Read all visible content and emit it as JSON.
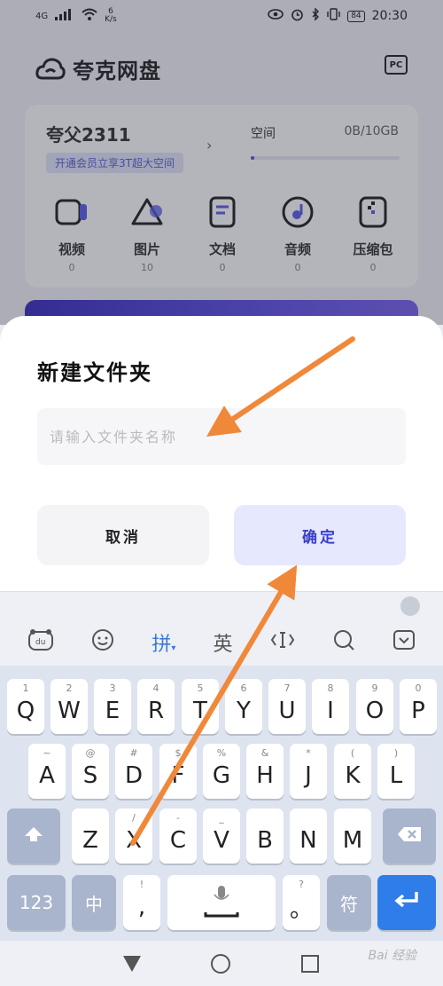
{
  "status_bar": {
    "network": "4G",
    "speed_value": "6",
    "speed_unit": "K/s",
    "battery": "84",
    "time": "20:30"
  },
  "app": {
    "title": "夸克网盘",
    "pc_label": "PC"
  },
  "user": {
    "name": "夸父2311",
    "vip_prompt": "开通会员立享3T超大空间",
    "space_label": "空间",
    "space_value": "0B/10GB",
    "space_used_fraction": 0
  },
  "categories": [
    {
      "label": "视频",
      "count": "0",
      "icon": "video-icon"
    },
    {
      "label": "图片",
      "count": "10",
      "icon": "image-icon"
    },
    {
      "label": "文档",
      "count": "0",
      "icon": "document-icon"
    },
    {
      "label": "音频",
      "count": "0",
      "icon": "audio-icon"
    },
    {
      "label": "压缩包",
      "count": "0",
      "icon": "archive-icon"
    }
  ],
  "dialog": {
    "title": "新建文件夹",
    "input_placeholder": "请输入文件夹名称",
    "input_value": "",
    "cancel_label": "取消",
    "confirm_label": "确定"
  },
  "keyboard_toolbar": {
    "pinyin_label": "拼",
    "english_label": "英"
  },
  "keyboard": {
    "row1": [
      {
        "num": "1",
        "key": "Q"
      },
      {
        "num": "2",
        "key": "W"
      },
      {
        "num": "3",
        "key": "E"
      },
      {
        "num": "4",
        "key": "R"
      },
      {
        "num": "5",
        "key": "T"
      },
      {
        "num": "6",
        "key": "Y"
      },
      {
        "num": "7",
        "key": "U"
      },
      {
        "num": "8",
        "key": "I"
      },
      {
        "num": "9",
        "key": "O"
      },
      {
        "num": "0",
        "key": "P"
      }
    ],
    "row2": [
      {
        "sym": "~",
        "key": "A"
      },
      {
        "sym": "@",
        "key": "S"
      },
      {
        "sym": "#",
        "key": "D"
      },
      {
        "sym": "$",
        "key": "F"
      },
      {
        "sym": "%",
        "key": "G"
      },
      {
        "sym": "&",
        "key": "H"
      },
      {
        "sym": "*",
        "key": "J"
      },
      {
        "sym": "(",
        "key": "K"
      },
      {
        "sym": ")",
        "key": "L"
      }
    ],
    "row3": [
      {
        "sym": "",
        "key": "Z"
      },
      {
        "sym": "/",
        "key": "X"
      },
      {
        "sym": "-",
        "key": "C"
      },
      {
        "sym": "_",
        "key": "V"
      },
      {
        "sym": "",
        "key": "B"
      },
      {
        "sym": "",
        "key": "N"
      },
      {
        "sym": "",
        "key": "M"
      }
    ],
    "num_label": "123",
    "lang_label": "中",
    "comma_sub": "!",
    "comma_label": ",",
    "period_sub": "?",
    "period_label": "。",
    "symbol_label": "符"
  },
  "watermark": "Bai 经验"
}
